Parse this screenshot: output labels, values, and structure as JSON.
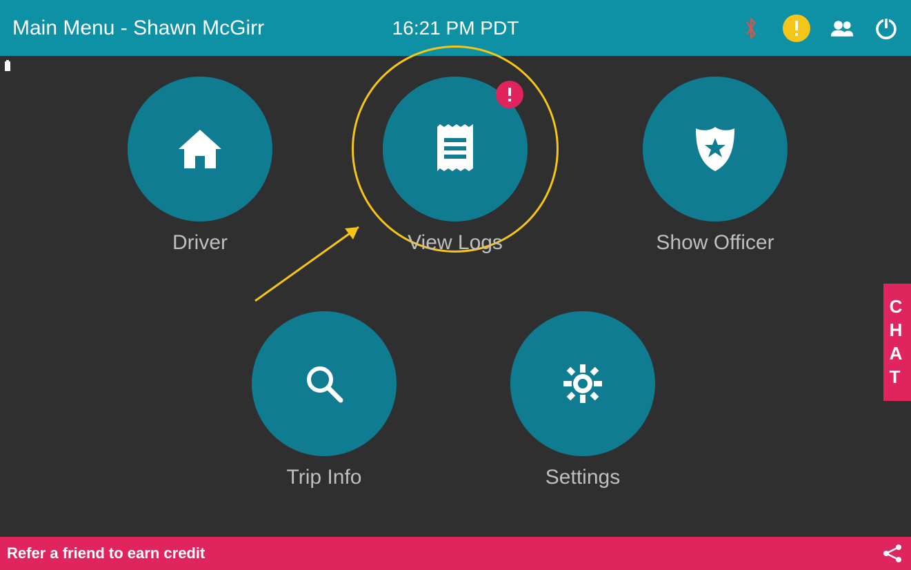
{
  "header": {
    "title": "Main Menu - Shawn McGirr",
    "time": "16:21 PM PDT"
  },
  "menu": {
    "driver": {
      "label": "Driver"
    },
    "viewlogs": {
      "label": "View Logs",
      "alert": "!"
    },
    "officer": {
      "label": "Show Officer"
    },
    "tripinfo": {
      "label": "Trip Info"
    },
    "settings": {
      "label": "Settings"
    }
  },
  "chat_tab": "CHAT",
  "footer": {
    "text": "Refer a friend to earn credit"
  },
  "colors": {
    "teal_header": "#0f91a5",
    "teal_circle": "#107c91",
    "dark_bg": "#2f2f2f",
    "pink": "#e0245e",
    "yellow": "#f5c518"
  }
}
